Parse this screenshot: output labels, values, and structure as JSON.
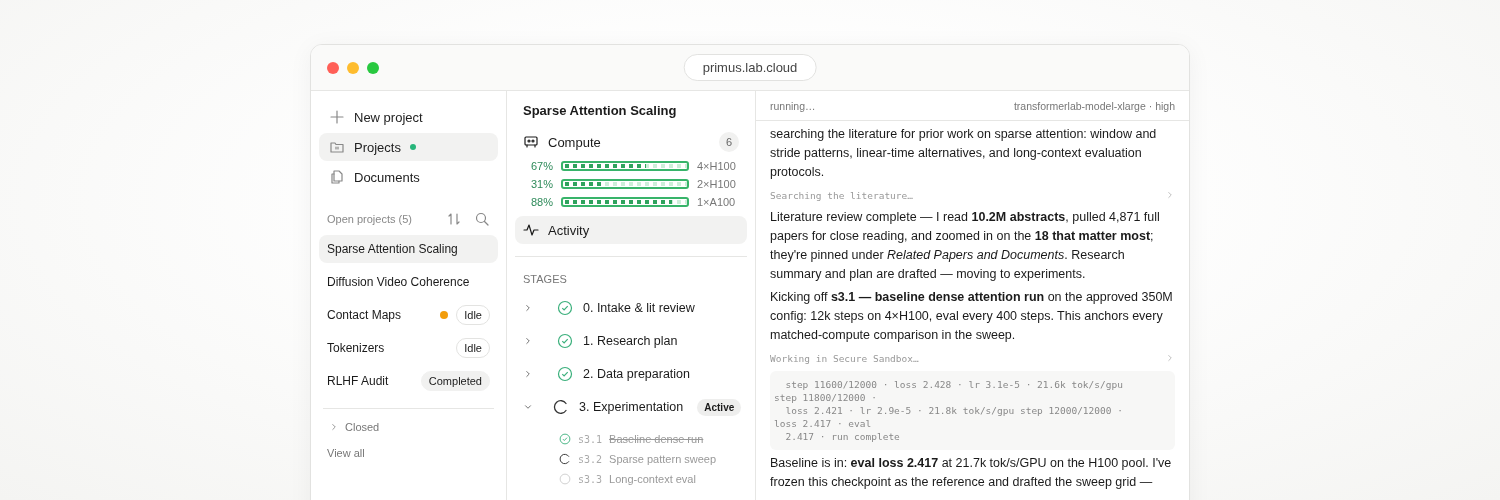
{
  "window": {
    "address": "primus.lab.cloud"
  },
  "sidebar": {
    "nav": [
      {
        "kind": "new",
        "label": "New project",
        "selected": false,
        "dot": false
      },
      {
        "kind": "projects",
        "label": "Projects",
        "selected": true,
        "dot": true
      },
      {
        "kind": "documents",
        "label": "Documents",
        "selected": false,
        "dot": false
      }
    ],
    "open_projects_label": "Open projects (5)",
    "projects": [
      {
        "name": "Sparse Attention Scaling",
        "selected": true
      },
      {
        "name": "Diffusion Video Coherence",
        "selected": false
      },
      {
        "name": "Contact Maps",
        "selected": false,
        "color": "#f29d0c",
        "badge": {
          "label": "Idle",
          "kind": "outline"
        }
      },
      {
        "name": "Tokenizers",
        "selected": false,
        "badge": {
          "label": "Idle",
          "kind": "outline"
        }
      },
      {
        "name": "RLHF Audit",
        "selected": false,
        "badge": {
          "label": "Completed",
          "kind": "filled"
        }
      }
    ],
    "closed": {
      "label": "Closed",
      "expanded": false
    },
    "view_all": "View all"
  },
  "project": {
    "title": "Sparse Attention Scaling",
    "compute": {
      "label": "Compute",
      "count": "6",
      "gpus": [
        {
          "percent": "67%",
          "level": 0.67,
          "name": "4×H100"
        },
        {
          "percent": "31%",
          "level": 0.31,
          "name": "2×H100"
        },
        {
          "percent": "88%",
          "level": 0.88,
          "name": "1×A100"
        }
      ]
    },
    "activity": {
      "label": "Activity",
      "selected": true
    },
    "stages_label": "STAGES",
    "stages": [
      {
        "label": "0. Intake & lit review",
        "kind": "done",
        "expanded": false
      },
      {
        "label": "1. Research plan",
        "kind": "done",
        "expanded": false
      },
      {
        "label": "2. Data preparation",
        "kind": "done",
        "expanded": false
      },
      {
        "label": "3. Experimentation",
        "kind": "running",
        "expanded": true,
        "badge": "Active",
        "children": [
          {
            "id": "s3.1",
            "label": "Baseline dense run",
            "kind": "done"
          },
          {
            "id": "s3.2",
            "label": "Sparse pattern sweep",
            "kind": "running"
          },
          {
            "id": "s3.3",
            "label": "Long-context eval",
            "kind": "pending"
          }
        ]
      }
    ]
  },
  "chat": {
    "status": "running…",
    "model": "transformerlab-model-xlarge · high",
    "messages": [
      {
        "kind": "text",
        "text": "searching the literature for prior work on sparse attention: window and stride patterns, linear-time alternatives, and long-context evaluation protocols."
      },
      {
        "kind": "tool",
        "text": "Searching the literature…"
      },
      {
        "kind": "text",
        "text": "Literature review complete — I read **10.2M abstracts**, pulled 4,871 full papers for close reading, and zoomed in on the **18 that matter most**; they're pinned under *Related Papers and Documents*. Research summary and plan are drafted — moving to experiments."
      },
      {
        "kind": "text",
        "text": "Kicking off **s3.1 — baseline dense attention run** on the approved 350M config: 12k steps on 4×H100, eval every 400 steps. This anchors every matched-compute comparison in the sweep."
      },
      {
        "kind": "tool",
        "text": "Working in Secure Sandbox…"
      },
      {
        "kind": "code",
        "lines": [
          "  step 11600/12000 · loss 2.428 · lr 3.1e-5 · 21.6k tok/s/gpu",
          "step 11800/12000 ·",
          "  loss 2.421 · lr 2.9e-5 · 21.8k tok/s/gpu step 12000/12000 ·",
          "loss 2.417 · eval",
          "  2.417 · run complete"
        ]
      },
      {
        "kind": "text",
        "text": "Baseline is in: **eval loss 2.417** at 21.7k tok/s/GPU on the H100 pool. I've frozen this checkpoint as the reference and drafted the sweep grid —"
      }
    ]
  }
}
